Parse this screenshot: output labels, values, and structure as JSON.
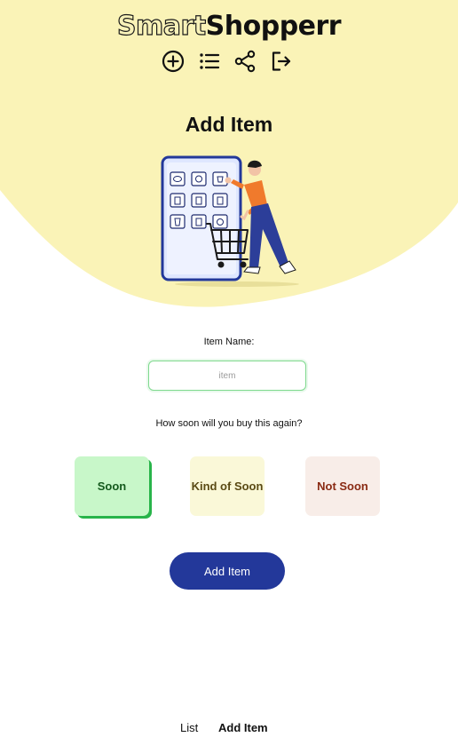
{
  "app": {
    "logo_part1": "Smart",
    "logo_part2": "Shopperr"
  },
  "header": {
    "icons": [
      "plus-circle-icon",
      "list-icon",
      "share-icon",
      "sign-out-icon"
    ]
  },
  "main": {
    "title": "Add Item",
    "illustration": "shopper-with-cart-illustration",
    "item_label": "Item Name:",
    "item_placeholder": "item",
    "item_value": "",
    "question": "How soon will you buy this again?",
    "urgency_options": [
      {
        "label": "Soon",
        "selected": true
      },
      {
        "label": "Kind of Soon",
        "selected": false
      },
      {
        "label": "Not Soon",
        "selected": false
      }
    ],
    "submit_label": "Add Item"
  },
  "nav": {
    "list_label": "List",
    "add_label": "Add Item",
    "active": "Add Item"
  },
  "colors": {
    "header_bg": "#faf3b7",
    "primary": "#23389a",
    "soon_bg": "#c8f7c9",
    "soon_accent": "#28b44a",
    "kind_bg": "#faf8d8",
    "not_bg": "#f8ede8",
    "input_border": "#7fd98e"
  }
}
